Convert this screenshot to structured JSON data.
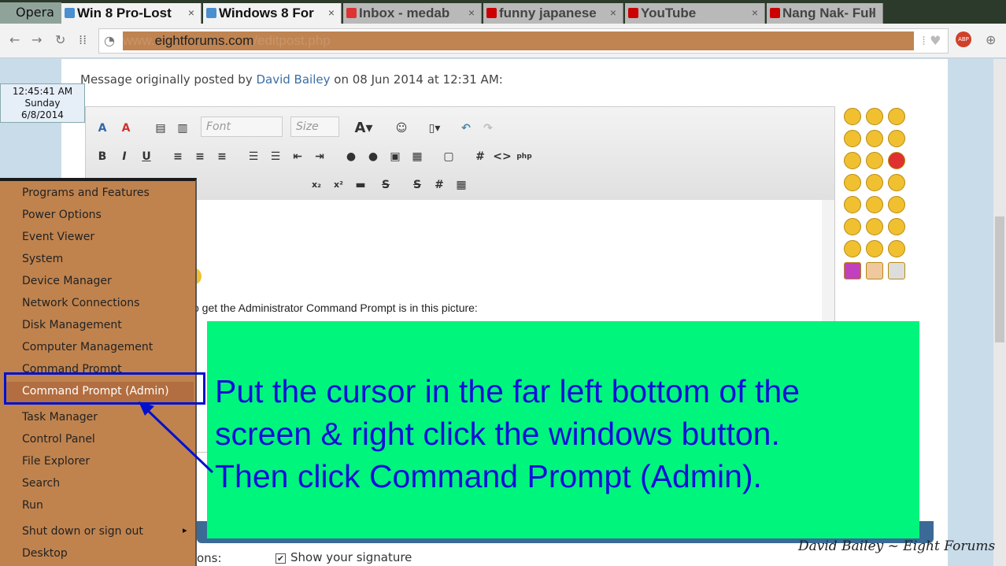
{
  "browser": {
    "name": "Opera",
    "tabs": [
      {
        "label": "Win 8 Pro-Lost",
        "active": true,
        "icon": "forum-favicon",
        "color": "#4a8fd0"
      },
      {
        "label": "Windows 8 For",
        "active": true,
        "icon": "forum-favicon",
        "color": "#4a8fd0"
      },
      {
        "label": "Inbox - medab",
        "active": false,
        "icon": "gmail-favicon",
        "color": "#d33"
      },
      {
        "label": "funny japanese",
        "active": false,
        "icon": "youtube-favicon",
        "color": "#c00"
      },
      {
        "label": "YouTube",
        "active": false,
        "icon": "youtube-favicon",
        "color": "#c00"
      },
      {
        "label": "Nang Nak- Full",
        "active": false,
        "icon": "youtube-favicon",
        "color": "#c00"
      }
    ],
    "url_domain": "eightforums.com",
    "url_prefix": "www.",
    "url_path": "/editpost.php",
    "adblock": "ABP"
  },
  "clock": {
    "time": "12:45:41 AM",
    "day": "Sunday",
    "date": "6/8/2014"
  },
  "post": {
    "prefix": "Message originally posted by",
    "author": "David Bailey",
    "suffix": "on 08 Jun 2014 at 12:31 AM:",
    "font_select": "Font",
    "size_select": "Size",
    "body_text": "o get the Administrator Command Prompt is in this picture:",
    "options_label": "ons:",
    "show_signature": "Show your signature",
    "show_signature_checked": true
  },
  "context_menu": {
    "items": [
      "Programs and Features",
      "Power Options",
      "Event Viewer",
      "System",
      "Device Manager",
      "Network Connections",
      "Disk Management",
      "Computer Management",
      "Command Prompt",
      "Command Prompt (Admin)",
      "Task Manager",
      "Control Panel",
      "File Explorer",
      "Search",
      "Run",
      "Shut down or sign out",
      "Desktop"
    ],
    "highlighted": "Command Prompt (Admin)"
  },
  "annotation": {
    "lines": [
      "Put the cursor in the far left bottom of the",
      "screen & right click the windows button.",
      "Then click Command Prompt (Admin)."
    ],
    "bg": "#00f57c",
    "text_color": "#1410d8"
  },
  "watermark": "David Bailey ~ Eight Forums"
}
